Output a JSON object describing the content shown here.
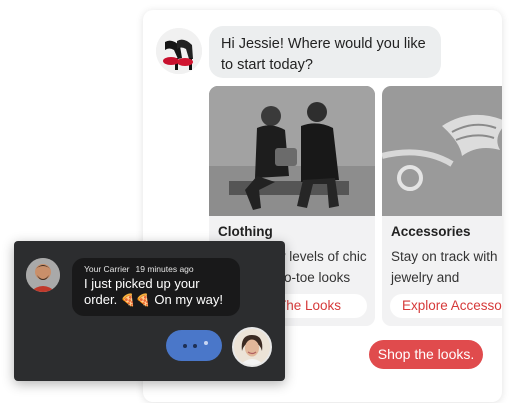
{
  "bot": {
    "greeting": "Hi Jessie! Where would you like to start today?",
    "avatar_icon": "red-sole-heels-icon"
  },
  "products": [
    {
      "title": "Clothing",
      "description": "Reach new levels of chic with head-to-toe looks",
      "button_label": "Shop The Looks"
    },
    {
      "title": "Accessories",
      "description": "Stay on track with iconic jewelry and",
      "button_label": "Explore Accessories"
    }
  ],
  "cta_label": "Shop the looks.",
  "notification": {
    "sender": "Your Carrier",
    "time": "19 minutes ago",
    "message_line1": "I just picked up your",
    "message_line2_pre": "order. ",
    "message_line2_post": " On my way!",
    "emoji": "pizza-icon"
  },
  "colors": {
    "accent_red": "#e04b4d",
    "link_red": "#d63a3a",
    "widget_bg": "#2c2d2f",
    "typing_blue": "#4a77c9"
  }
}
